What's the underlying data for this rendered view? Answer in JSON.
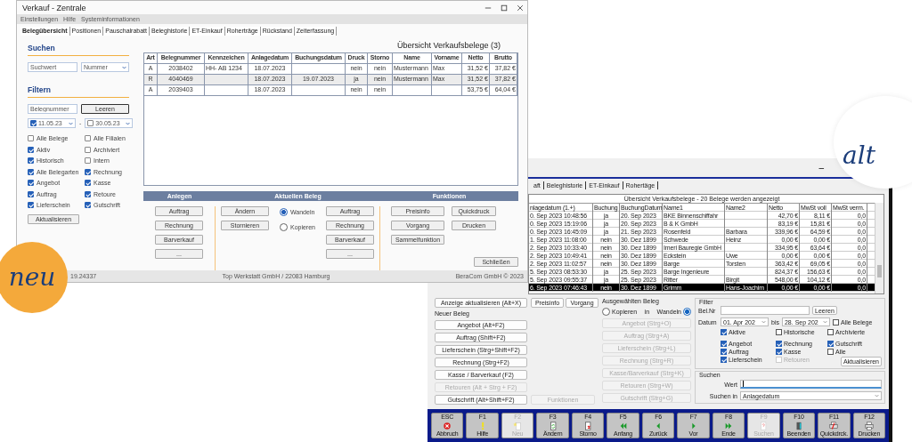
{
  "new_window": {
    "title": "Verkauf - Zentrale",
    "menu": [
      "Einstellungen",
      "Hilfe",
      "Systeminformationen"
    ],
    "tabs": [
      {
        "label": "Belegübersicht",
        "selected": true
      },
      {
        "label": "Positionen",
        "selected": false
      },
      {
        "label": "Pauschalrabatt",
        "selected": false
      },
      {
        "label": "Beleghistorie",
        "selected": false
      },
      {
        "label": "ET-Einkauf",
        "selected": false
      },
      {
        "label": "Roherträge",
        "selected": false
      },
      {
        "label": "Rückstand",
        "selected": false
      },
      {
        "label": "Zeiterfassung",
        "selected": false
      }
    ],
    "search": {
      "heading": "Suchen",
      "placeholder": "Suchwert",
      "type_select": "Nummer"
    },
    "filter": {
      "heading": "Filtern",
      "number_placeholder": "Belegnummer",
      "clear_button": "Leeren",
      "date_from": {
        "value": "11.05.23",
        "checked": true
      },
      "separator": "-",
      "date_to": {
        "value": "30.05.23",
        "checked": false
      },
      "checkboxes": [
        {
          "label": "Alle Belege",
          "checked": false
        },
        {
          "label": "Alle Filialen",
          "checked": false
        },
        {
          "label": "Aktiv",
          "checked": true
        },
        {
          "label": "Archiviert",
          "checked": false
        },
        {
          "label": "Historisch",
          "checked": true
        },
        {
          "label": "Intern",
          "checked": false
        },
        {
          "label": "Alle Belegarten",
          "checked": true
        },
        {
          "label": "Rechnung",
          "checked": true
        },
        {
          "label": "Angebot",
          "checked": true
        },
        {
          "label": "Kasse",
          "checked": true
        },
        {
          "label": "Auftrag",
          "checked": true
        },
        {
          "label": "Retoure",
          "checked": true
        },
        {
          "label": "Lieferschein",
          "checked": true
        },
        {
          "label": "Gutschrift",
          "checked": true
        }
      ],
      "refresh_button": "Aktualisieren"
    },
    "table": {
      "title": "Übersicht Verkaufsbelege (3)",
      "columns": [
        "Art",
        "Belegnummer",
        "Kennzeichen",
        "Anlagedatum",
        "Buchungsdatum",
        "Druck",
        "Storno",
        "Name",
        "Vorname",
        "Netto",
        "Brutto"
      ],
      "rows": [
        {
          "cells": [
            "A",
            "2038402",
            "HH- AB 1234",
            "18.07.2023",
            "",
            "nein",
            "nein",
            "Mustermann",
            "Max",
            "31,52 €",
            "37,82 €"
          ],
          "selected": false
        },
        {
          "cells": [
            "R",
            "4040469",
            "",
            "18.07.2023",
            "19.07.2023",
            "ja",
            "nein",
            "Mustermann",
            "Max",
            "31,52 €",
            "37,82 €"
          ],
          "selected": true
        },
        {
          "cells": [
            "A",
            "2039403",
            "",
            "18.07.2023",
            "",
            "nein",
            "nein",
            "",
            "",
            "53,75 €",
            "64,04 €"
          ],
          "selected": false
        }
      ]
    },
    "sections": [
      "Anlegen",
      "Aktuellen Beleg",
      "Funktionen"
    ],
    "create_buttons": [
      "Auftrag",
      "Rechnung",
      "Barverkauf",
      "..."
    ],
    "current_left_buttons": [
      "Ändern",
      "Stornieren"
    ],
    "current_radios": [
      {
        "label": "Wandeln",
        "selected": true
      },
      {
        "label": "Kopieren",
        "selected": false
      }
    ],
    "current_right_buttons": [
      "Auftrag",
      "Rechnung",
      "Barverkauf",
      "..."
    ],
    "function_buttons": [
      "Preisinfo",
      "Quickdruck",
      "Vorgang",
      "Drucken",
      "Sammelfunktion"
    ],
    "close_button": "Schließen",
    "status_bar": {
      "version": "19.24337",
      "company": "Top Werkstatt GmbH / 22083 Hamburg",
      "copyright": "BeraCom GmbH © 2023"
    }
  },
  "old_window": {
    "minimize": "–",
    "tabs": [
      {
        "label": "aft",
        "selected": false
      },
      {
        "label": "Beleghistorie",
        "selected": false
      },
      {
        "label": "ET-Einkauf",
        "selected": false
      },
      {
        "label": "Rohertäge",
        "selected": false
      }
    ],
    "table": {
      "title": "Übersicht Verkaufsbelege - 20 Belege werden angezeigt",
      "columns": [
        "nlagedatum (1.+)",
        "Buchung",
        "BuchungDatum",
        "Name1",
        "Name2",
        "Netto",
        "MwSt voll",
        "MwSt verm."
      ],
      "rows": [
        {
          "cells": [
            "0. Sep 2023 10:48:56",
            "ja",
            "20. Sep 2023",
            "BKE Binnenschiffahr",
            "",
            "42,70 €",
            "8,11 €",
            "0,0"
          ],
          "selected": false
        },
        {
          "cells": [
            "0. Sep 2023 15:19:06",
            "ja",
            "20. Sep 2023",
            "B & K GmbH",
            "",
            "83,19 €",
            "15,81 €",
            "0,0"
          ],
          "selected": false
        },
        {
          "cells": [
            "0. Sep 2023 16:45:09",
            "ja",
            "21. Sep 2023",
            "Rosenfeld",
            "Barbara",
            "339,96 €",
            "64,59 €",
            "0,0"
          ],
          "selected": false
        },
        {
          "cells": [
            "1. Sep 2023 11:08:00",
            "nein",
            "30. Dez 1899",
            "Schwede",
            "Heinz",
            "0,00 €",
            "0,00 €",
            "0,0"
          ],
          "selected": false
        },
        {
          "cells": [
            "2. Sep 2023 10:33:40",
            "nein",
            "30. Dez 1899",
            "Imeri Bauregie GmbH",
            "",
            "334,95 €",
            "63,64 €",
            "0,0"
          ],
          "selected": false
        },
        {
          "cells": [
            "2. Sep 2023 10:49:41",
            "nein",
            "30. Dez 1899",
            "Eckstein",
            "Uwe",
            "0,00 €",
            "0,00 €",
            "0,0"
          ],
          "selected": false
        },
        {
          "cells": [
            "2. Sep 2023 11:02:57",
            "nein",
            "30. Dez 1899",
            "Barge",
            "Torsten",
            "363,42 €",
            "69,05 €",
            "0,0"
          ],
          "selected": false
        },
        {
          "cells": [
            "5. Sep 2023 08:53:30",
            "ja",
            "25. Sep 2023",
            "Barge Ingenieure",
            "",
            "824,37 €",
            "156,63 €",
            "0,0"
          ],
          "selected": false
        },
        {
          "cells": [
            "5. Sep 2023 09:55:37",
            "ja",
            "25. Sep 2023",
            "Ritter",
            "Birgit",
            "548,00 €",
            "104,12 €",
            "0,0"
          ],
          "selected": false
        },
        {
          "cells": [
            "6. Sep 2023 07:46:43",
            "nein",
            "30. Dez 1899",
            "Grimm",
            "Hans-Joachim",
            "0,00 €",
            "0,00 €",
            "0,0"
          ],
          "selected": true
        }
      ]
    },
    "refresh_button": "Anzeige aktualisieren (Alt+X)",
    "new_group": {
      "label": "Neuer Beleg",
      "buttons": [
        {
          "label": "Angebot (Alt+F2)",
          "disabled": false
        },
        {
          "label": "Auftrag (Shift+F2)",
          "disabled": false
        },
        {
          "label": "Lieferschein (Strg+Shift+F2)",
          "disabled": false
        },
        {
          "label": "Rechnung (Strg+F2)",
          "disabled": false
        },
        {
          "label": "Kasse / Barverkauf (F2)",
          "disabled": false
        },
        {
          "label": "Retouren (Alt + Strg + F2)",
          "disabled": true
        },
        {
          "label": "Gutschrift (Alt+Shift+F2)",
          "disabled": false
        }
      ]
    },
    "middle_buttons": [
      "Preisinfo",
      "Vorgang"
    ],
    "functions_button": {
      "label": "Funktionen",
      "disabled": true
    },
    "selected_group": {
      "label": "Ausgewählten Beleg",
      "connector": "in",
      "radios": [
        {
          "label": "Kopieren",
          "selected": false
        },
        {
          "label": "Wandeln",
          "selected": true
        }
      ],
      "buttons": [
        {
          "label": "Angebot (Strg+O)",
          "disabled": true
        },
        {
          "label": "Auftrag (Strg+A)",
          "disabled": true
        },
        {
          "label": "Lieferschein (Strg+L)",
          "disabled": true
        },
        {
          "label": "Rechnung (Strg+R)",
          "disabled": true
        },
        {
          "label": "Kasse/Barverkauf (Strg+K)",
          "disabled": true
        },
        {
          "label": "Retouren (Strg+W)",
          "disabled": true
        },
        {
          "label": "Gutschrift (Strg+G)",
          "disabled": true
        }
      ]
    },
    "filter": {
      "label": "Filter",
      "number_label": "Bel.Nr",
      "clear_button": "Leeren",
      "date_label": "Datum",
      "date_from": "01. Apr 202",
      "to_label": "bis",
      "date_to": "28. Sep 202",
      "all_documents": {
        "label": "Alle Belege",
        "checked": false
      },
      "status_checkboxes": [
        {
          "label": "Aktive",
          "checked": true
        },
        {
          "label": "Historische",
          "checked": false
        },
        {
          "label": "Archivierte",
          "checked": false
        }
      ],
      "type_checkboxes": [
        {
          "label": "Angebot",
          "checked": true,
          "disabled": false
        },
        {
          "label": "Rechnung",
          "checked": true,
          "disabled": false
        },
        {
          "label": "Gutschrift",
          "checked": true,
          "disabled": false
        },
        {
          "label": "Auftrag",
          "checked": true,
          "disabled": false
        },
        {
          "label": "Kasse",
          "checked": true,
          "disabled": false
        },
        {
          "label": "Alle",
          "checked": false,
          "disabled": false
        },
        {
          "label": "Lieferschein",
          "checked": true,
          "disabled": false
        },
        {
          "label": "Retouren",
          "checked": false,
          "disabled": true
        }
      ],
      "refresh_button": "Aktualisieren"
    },
    "search": {
      "label": "Suchen",
      "value_label": "Wert",
      "in_label": "Suchen in",
      "in_select": "Anlagedatum"
    },
    "function_keys": [
      {
        "key": "ESC",
        "label": "Abbruch",
        "kind": "cancel",
        "disabled": false
      },
      {
        "key": "F1",
        "label": "Hilfe",
        "kind": "help",
        "disabled": false
      },
      {
        "key": "F2",
        "label": "Neu",
        "kind": "new",
        "disabled": true
      },
      {
        "key": "F3",
        "label": "Ändern",
        "kind": "edit",
        "disabled": false
      },
      {
        "key": "F4",
        "label": "Storno",
        "kind": "cancel-doc",
        "disabled": false
      },
      {
        "key": "F5",
        "label": "Anfang",
        "kind": "first",
        "disabled": false
      },
      {
        "key": "F6",
        "label": "Zurück",
        "kind": "prev",
        "disabled": false
      },
      {
        "key": "F7",
        "label": "Vor",
        "kind": "next",
        "disabled": false
      },
      {
        "key": "F8",
        "label": "Ende",
        "kind": "last",
        "disabled": false
      },
      {
        "key": "F9",
        "label": "Suchen",
        "kind": "find",
        "disabled": true
      },
      {
        "key": "F10",
        "label": "Beenden",
        "kind": "exit",
        "disabled": false
      },
      {
        "key": "F11",
        "label": "Quickdrck.",
        "kind": "quickprint",
        "disabled": false
      },
      {
        "key": "F12",
        "label": "Drucken",
        "kind": "print",
        "disabled": false
      }
    ]
  },
  "badges": [
    {
      "text": "neu",
      "kind": "new"
    },
    {
      "text": "alt",
      "kind": "old"
    }
  ]
}
